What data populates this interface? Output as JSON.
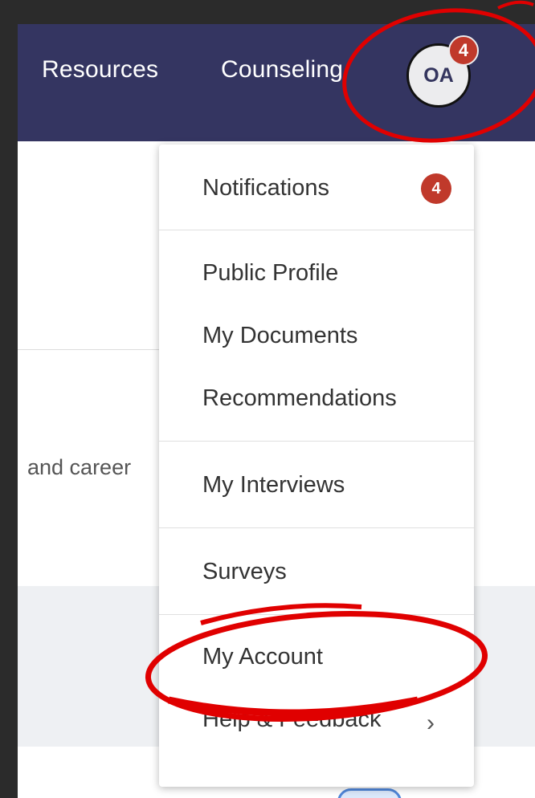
{
  "nav": {
    "links": [
      "Resources",
      "Counseling"
    ],
    "avatar_initials": "OA",
    "avatar_badge": "4"
  },
  "background": {
    "visible_text": "and career"
  },
  "menu": {
    "notifications": {
      "label": "Notifications",
      "count": "4"
    },
    "items": [
      "Public Profile",
      "My Documents",
      "Recommendations",
      "My Interviews",
      "Surveys",
      "My Account",
      "Help & Feedback"
    ],
    "submenu_icon": "chevron-right-icon"
  },
  "colors": {
    "nav_bg": "#343561",
    "badge": "#c0392b",
    "annotation": "#e00000"
  }
}
